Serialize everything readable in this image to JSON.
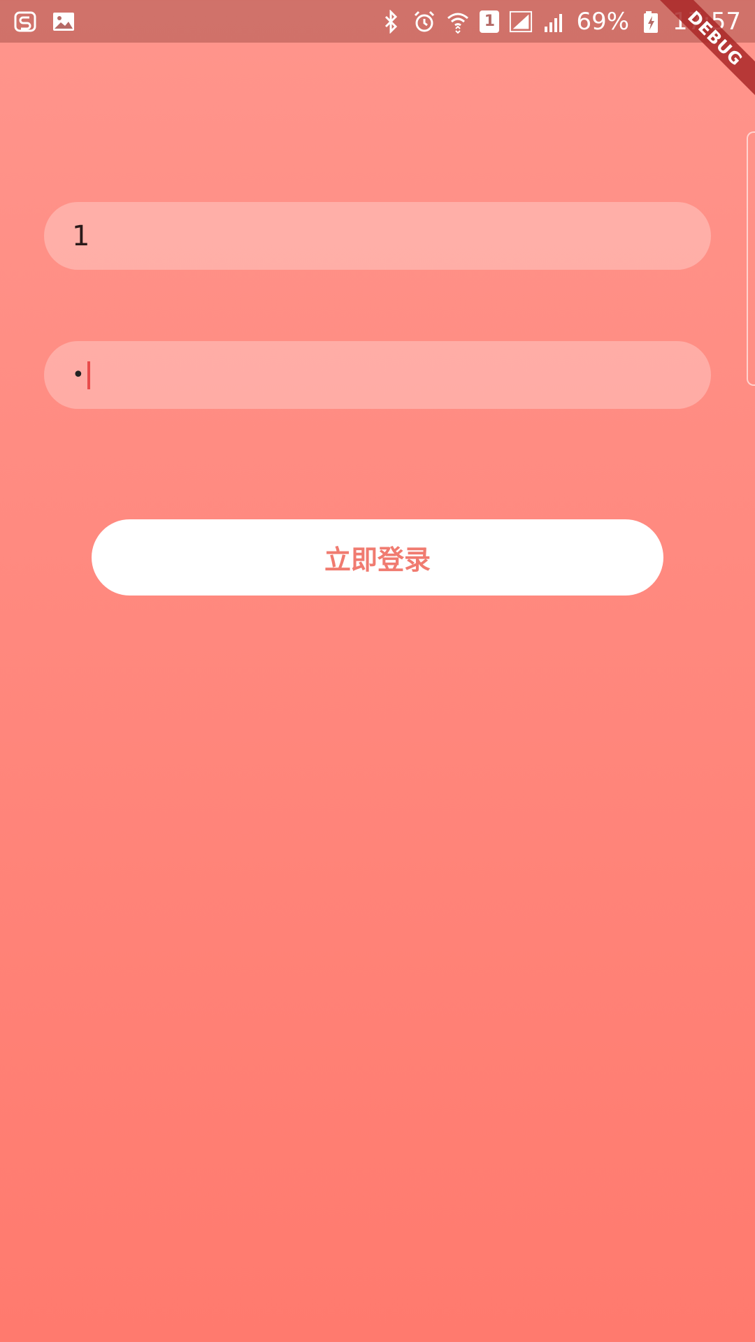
{
  "status_bar": {
    "battery": "69%",
    "time": "17:57",
    "sim_slot": "1",
    "icons": [
      "weibo-like-app-icon",
      "image-icon",
      "bluetooth-icon",
      "alarm-icon",
      "wifi-icon",
      "sim-icon",
      "signal-icon",
      "signal-icon",
      "battery-icon"
    ]
  },
  "debug_banner": "DEBUG",
  "form": {
    "username_value": "1",
    "password_mask": "•",
    "login_label": "立即登录"
  },
  "colors": {
    "background_top": "#ff958c",
    "background_bottom": "#ff7a6e",
    "button_text": "#f07b70",
    "caret": "#e84c4c"
  }
}
